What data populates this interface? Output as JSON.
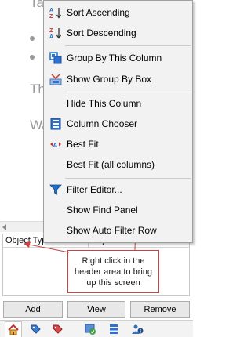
{
  "background": {
    "text_lines": [
      "Tal",
      "Th",
      "Wa"
    ]
  },
  "context_menu": {
    "items": [
      {
        "label": "Sort Ascending",
        "icon": "sort-ascending-icon"
      },
      {
        "label": "Sort Descending",
        "icon": "sort-descending-icon"
      },
      {
        "label": "Group By This Column",
        "icon": "group-by-column-icon"
      },
      {
        "label": "Show Group By Box",
        "icon": "group-by-box-icon"
      },
      {
        "label": "Hide This Column",
        "icon": ""
      },
      {
        "label": "Column Chooser",
        "icon": "column-chooser-icon"
      },
      {
        "label": "Best Fit",
        "icon": "best-fit-icon"
      },
      {
        "label": "Best Fit (all columns)",
        "icon": ""
      },
      {
        "label": "Filter Editor...",
        "icon": "filter-icon"
      },
      {
        "label": "Show Find Panel",
        "icon": ""
      },
      {
        "label": "Show Auto Filter Row",
        "icon": ""
      }
    ]
  },
  "grid": {
    "columns": [
      "Object Type",
      "Object Ref#"
    ]
  },
  "callout": {
    "text": "Right click in the header area to bring up this screen",
    "border_color": "#d04040"
  },
  "buttons": {
    "add": "Add",
    "view": "View",
    "remove": "Remove"
  },
  "tabs": [
    {
      "icon": "home-icon",
      "active": true
    },
    {
      "icon": "tag-blue-icon",
      "active": false
    },
    {
      "icon": "tag-red-icon",
      "active": false
    },
    {
      "icon": "check-tab-icon",
      "active": false
    },
    {
      "icon": "list-icon",
      "active": false
    },
    {
      "icon": "people-icon",
      "active": false
    }
  ],
  "colors": {
    "accent_blue": "#1e6fc9",
    "accent_red": "#d03030"
  }
}
